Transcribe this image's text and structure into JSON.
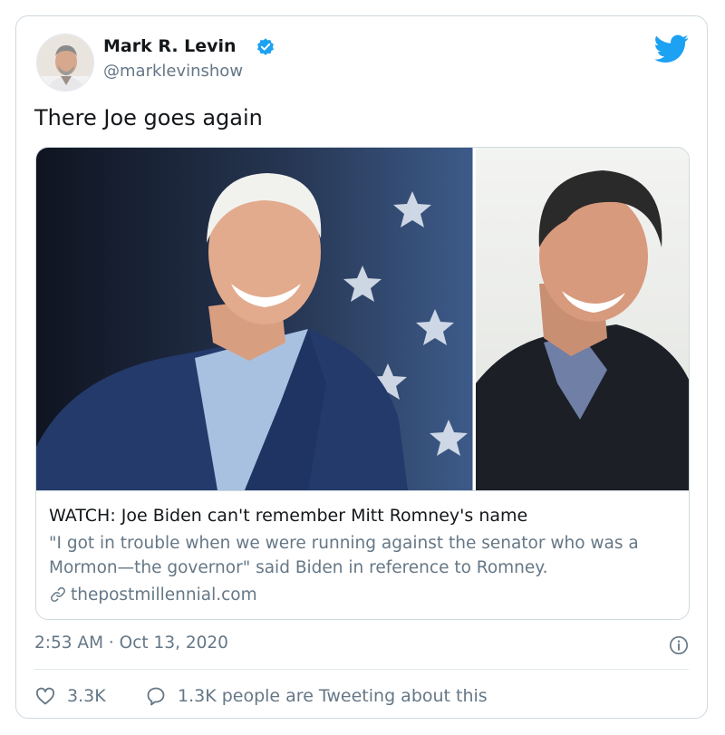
{
  "author": {
    "display_name": "Mark R. Levin",
    "handle": "@marklevinshow",
    "verified": true,
    "avatar_icon": "avatar-photo"
  },
  "brand": {
    "logo_icon": "twitter-bird-icon",
    "accent": "#1da1f2"
  },
  "tweet": {
    "text": "There Joe goes again"
  },
  "link_card": {
    "title": "WATCH: Joe Biden can't remember Mitt Romney's name",
    "description": "\"I got in trouble when we were running against the senator who was a Mormon—the governor\" said Biden in reference to Romney.",
    "domain": "thepostmillennial.com",
    "link_icon": "link-icon",
    "images": [
      "photo-left",
      "photo-right"
    ]
  },
  "meta": {
    "timestamp": "2:53 AM · Oct 13, 2020",
    "info_icon": "info-icon"
  },
  "actions": {
    "likes": "3.3K",
    "like_icon": "heart-icon",
    "conversation": "1.3K people are Tweeting about this",
    "conversation_icon": "speech-bubble-icon"
  },
  "colors": {
    "text": "#14171a",
    "secondary": "#657786",
    "border": "#cfd9de",
    "verified": "#1da1f2"
  }
}
